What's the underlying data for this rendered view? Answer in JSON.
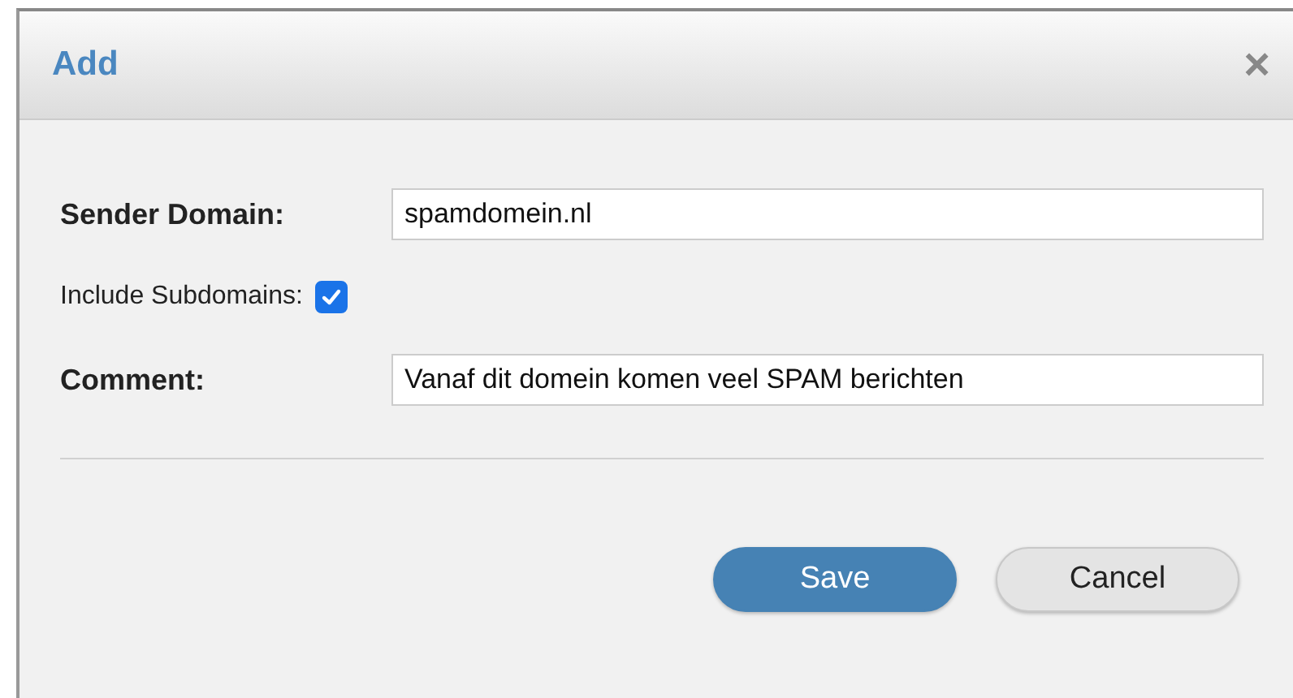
{
  "dialog": {
    "title": "Add",
    "close_label": "×"
  },
  "fields": [
    {
      "kind": "text",
      "label": "Sender Domain:",
      "bold": true,
      "value": "spamdomein.nl"
    },
    {
      "kind": "checkbox",
      "label": "Include Subdomains:",
      "bold": false,
      "checked": true
    },
    {
      "kind": "text",
      "label": "Comment:",
      "bold": true,
      "value": "Vanaf dit domein komen veel SPAM berichten"
    }
  ],
  "buttons": [
    {
      "label": "Save",
      "primary": true
    },
    {
      "label": "Cancel",
      "primary": false
    }
  ]
}
